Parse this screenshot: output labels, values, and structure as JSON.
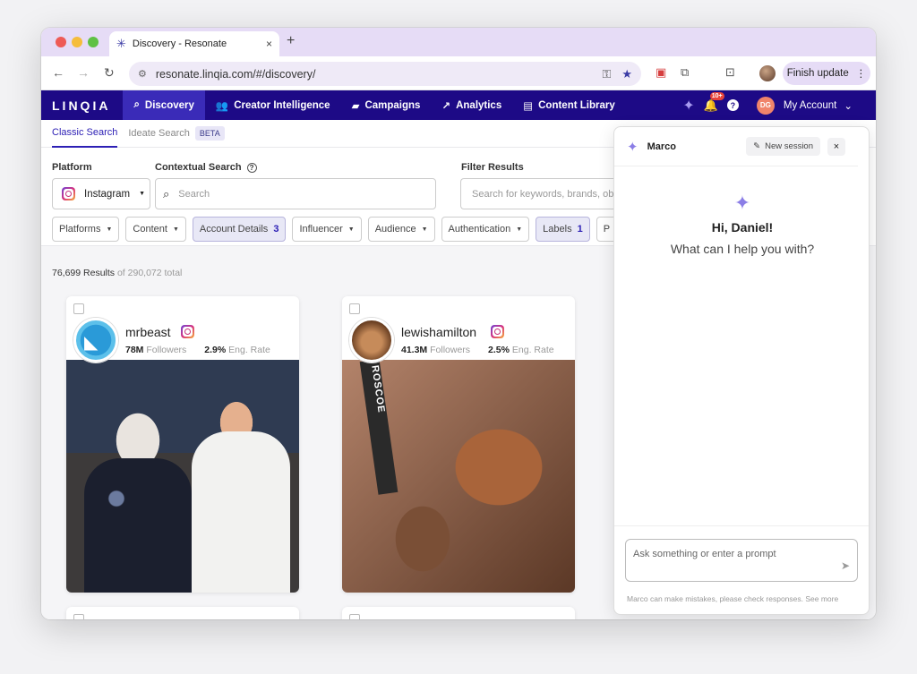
{
  "browser": {
    "tab_title": "Discovery - Resonate",
    "tab_close": "×",
    "new_tab": "+",
    "url": "resonate.linqia.com/#/discovery/",
    "finish_update": "Finish update",
    "menu_dots": "⋮"
  },
  "nav": {
    "logo": "LINQIA",
    "items": [
      {
        "label": "Discovery",
        "icon": "search-icon"
      },
      {
        "label": "Creator Intelligence",
        "icon": "users-icon"
      },
      {
        "label": "Campaigns",
        "icon": "briefcase-icon"
      },
      {
        "label": "Analytics",
        "icon": "trend-icon"
      },
      {
        "label": "Content Library",
        "icon": "library-icon"
      }
    ],
    "notification_count": "10+",
    "help": "?",
    "avatar_initials": "DG",
    "account_label": "My Account"
  },
  "subtabs": {
    "classic": "Classic Search",
    "ideate": "Ideate Search",
    "beta": "BETA"
  },
  "filters": {
    "platform_label": "Platform",
    "platform_value": "Instagram",
    "contextual_label": "Contextual Search",
    "contextual_placeholder": "Search",
    "filter_results_label": "Filter Results",
    "filter_placeholder": "Search for keywords, brands, ob",
    "chips": [
      {
        "label": "Platforms",
        "count": ""
      },
      {
        "label": "Content",
        "count": ""
      },
      {
        "label": "Account Details",
        "count": "3"
      },
      {
        "label": "Influencer",
        "count": ""
      },
      {
        "label": "Audience",
        "count": ""
      },
      {
        "label": "Authentication",
        "count": ""
      },
      {
        "label": "Labels",
        "count": "1"
      },
      {
        "label": "P",
        "count": ""
      }
    ]
  },
  "results": {
    "count": "76,699 Results",
    "total": "of 290,072 total",
    "cards": [
      {
        "handle": "mrbeast",
        "followers": "78M",
        "followers_label": "Followers",
        "eng": "2.9%",
        "eng_label": "Eng. Rate"
      },
      {
        "handle": "lewishamilton",
        "followers": "41.3M",
        "followers_label": "Followers",
        "eng": "2.5%",
        "eng_label": "Eng. Rate"
      }
    ],
    "collar_text": "ROSCOE"
  },
  "marco": {
    "name": "Marco",
    "new_session": "New session",
    "close": "×",
    "greeting": "Hi, Daniel!",
    "question": "What can I help you with?",
    "prompt_placeholder": "Ask something or enter a prompt",
    "disclaimer": "Marco can make mistakes, please check responses. See more"
  },
  "colors": {
    "nav_bg": "#1d0a86",
    "accent": "#2d20b5",
    "chrome_tab_strip": "#e6dcf6"
  }
}
